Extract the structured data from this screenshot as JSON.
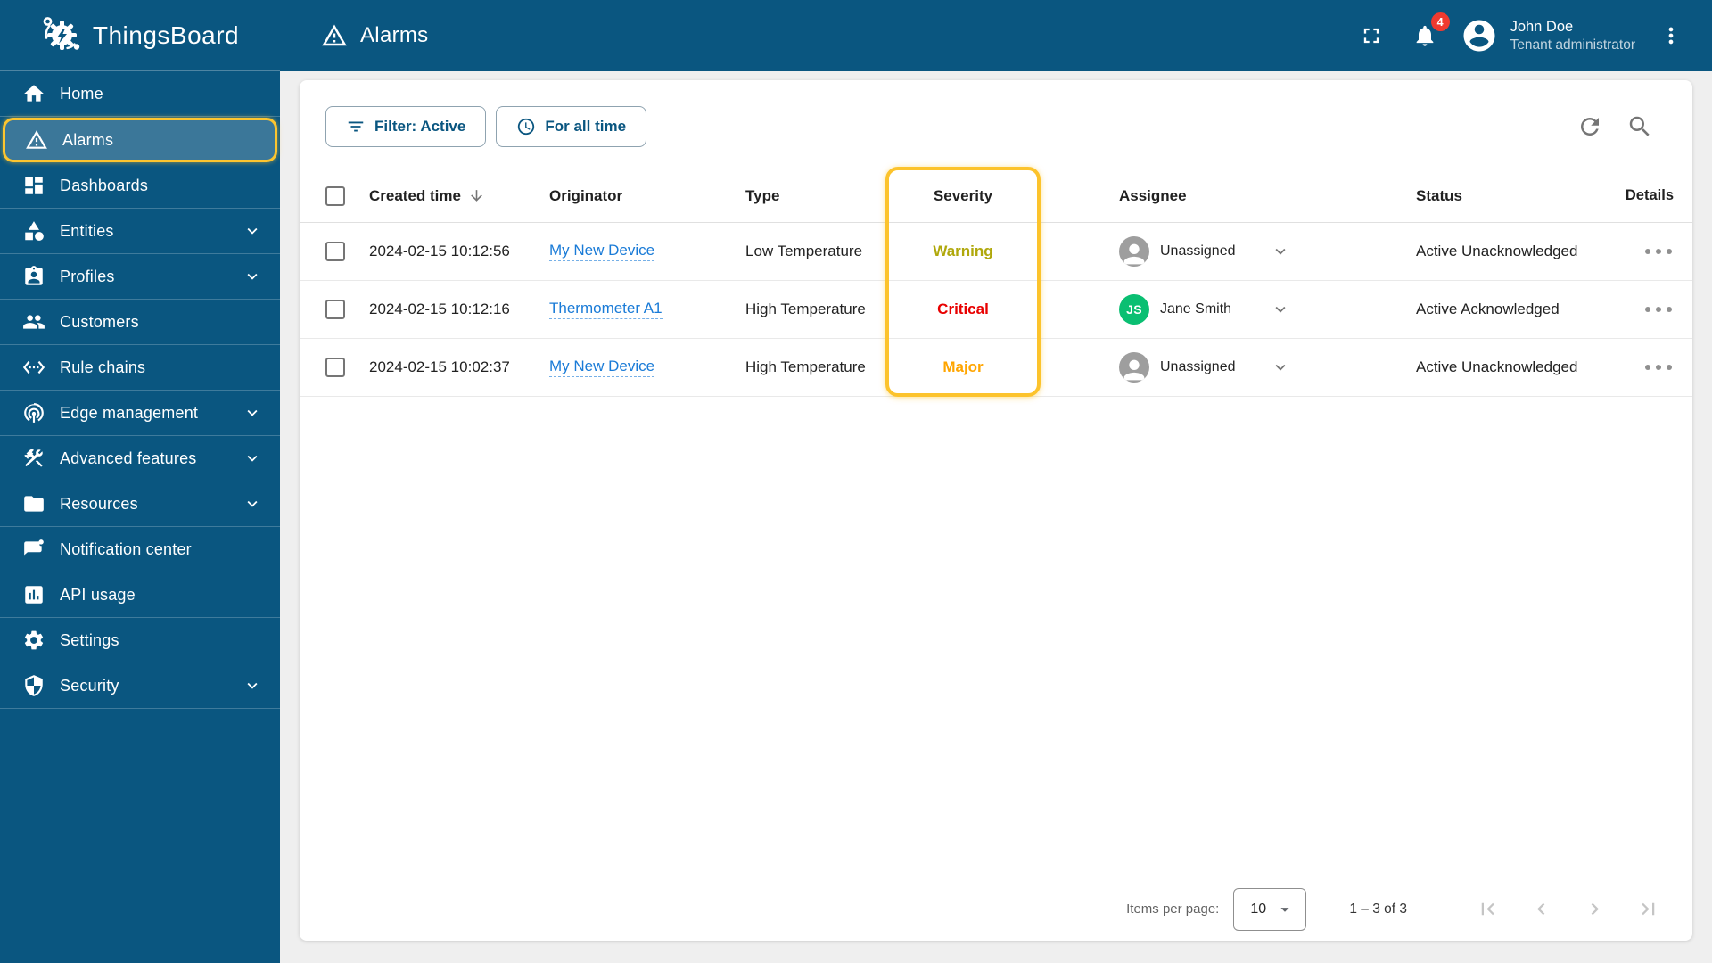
{
  "app": {
    "name": "ThingsBoard"
  },
  "colors": {
    "primary": "#0a5680",
    "highlight": "#fcc32c",
    "link": "#1a7bd7",
    "badge": "#ef3a30",
    "severity_warning": "#b0a80c",
    "severity_critical": "#e80000",
    "severity_major": "#ffa500",
    "assignee_green": "#0abf72"
  },
  "sidebar": {
    "items": [
      {
        "id": "home",
        "label": "Home",
        "icon": "home-icon",
        "active": false,
        "expandable": false
      },
      {
        "id": "alarms",
        "label": "Alarms",
        "icon": "warning-icon",
        "active": true,
        "expandable": false
      },
      {
        "id": "dashboards",
        "label": "Dashboards",
        "icon": "dashboards-icon",
        "active": false,
        "expandable": false
      },
      {
        "id": "entities",
        "label": "Entities",
        "icon": "entities-icon",
        "active": false,
        "expandable": true
      },
      {
        "id": "profiles",
        "label": "Profiles",
        "icon": "profiles-icon",
        "active": false,
        "expandable": true
      },
      {
        "id": "customers",
        "label": "Customers",
        "icon": "customers-icon",
        "active": false,
        "expandable": false
      },
      {
        "id": "rule-chains",
        "label": "Rule chains",
        "icon": "rule-chains-icon",
        "active": false,
        "expandable": false
      },
      {
        "id": "edge-management",
        "label": "Edge management",
        "icon": "antenna-icon",
        "active": false,
        "expandable": true
      },
      {
        "id": "advanced-features",
        "label": "Advanced features",
        "icon": "tools-icon",
        "active": false,
        "expandable": true
      },
      {
        "id": "resources",
        "label": "Resources",
        "icon": "folder-icon",
        "active": false,
        "expandable": true
      },
      {
        "id": "notification-center",
        "label": "Notification center",
        "icon": "notification-icon",
        "active": false,
        "expandable": false
      },
      {
        "id": "api-usage",
        "label": "API usage",
        "icon": "bar-chart-icon",
        "active": false,
        "expandable": false
      },
      {
        "id": "settings",
        "label": "Settings",
        "icon": "gear-icon",
        "active": false,
        "expandable": false
      },
      {
        "id": "security",
        "label": "Security",
        "icon": "shield-icon",
        "active": false,
        "expandable": true
      }
    ]
  },
  "header": {
    "title": "Alarms",
    "notification_count": "4",
    "user": {
      "name": "John Doe",
      "role": "Tenant administrator"
    }
  },
  "toolbar": {
    "filter_button": "Filter: Active",
    "time_button": "For all time"
  },
  "table": {
    "headers": {
      "created": "Created time",
      "originator": "Originator",
      "type": "Type",
      "severity": "Severity",
      "assignee": "Assignee",
      "status": "Status",
      "details": "Details"
    },
    "rows": [
      {
        "created": "2024-02-15 10:12:56",
        "originator": "My New Device",
        "type": "Low Temperature",
        "severity": "Warning",
        "severity_color": "#b0a80c",
        "assignee": "Unassigned",
        "status": "Active Unacknowledged"
      },
      {
        "created": "2024-02-15 10:12:16",
        "originator": "Thermometer A1",
        "type": "High Temperature",
        "severity": "Critical",
        "severity_color": "#e80000",
        "assignee": "Jane Smith",
        "assignee_initials": "JS",
        "assignee_color": "#0abf72",
        "status": "Active Acknowledged"
      },
      {
        "created": "2024-02-15 10:02:37",
        "originator": "My New Device",
        "type": "High Temperature",
        "severity": "Major",
        "severity_color": "#ffa500",
        "assignee": "Unassigned",
        "status": "Active Unacknowledged"
      }
    ]
  },
  "pagination": {
    "items_per_page_label": "Items per page:",
    "page_size": "10",
    "range": "1 – 3 of 3"
  }
}
